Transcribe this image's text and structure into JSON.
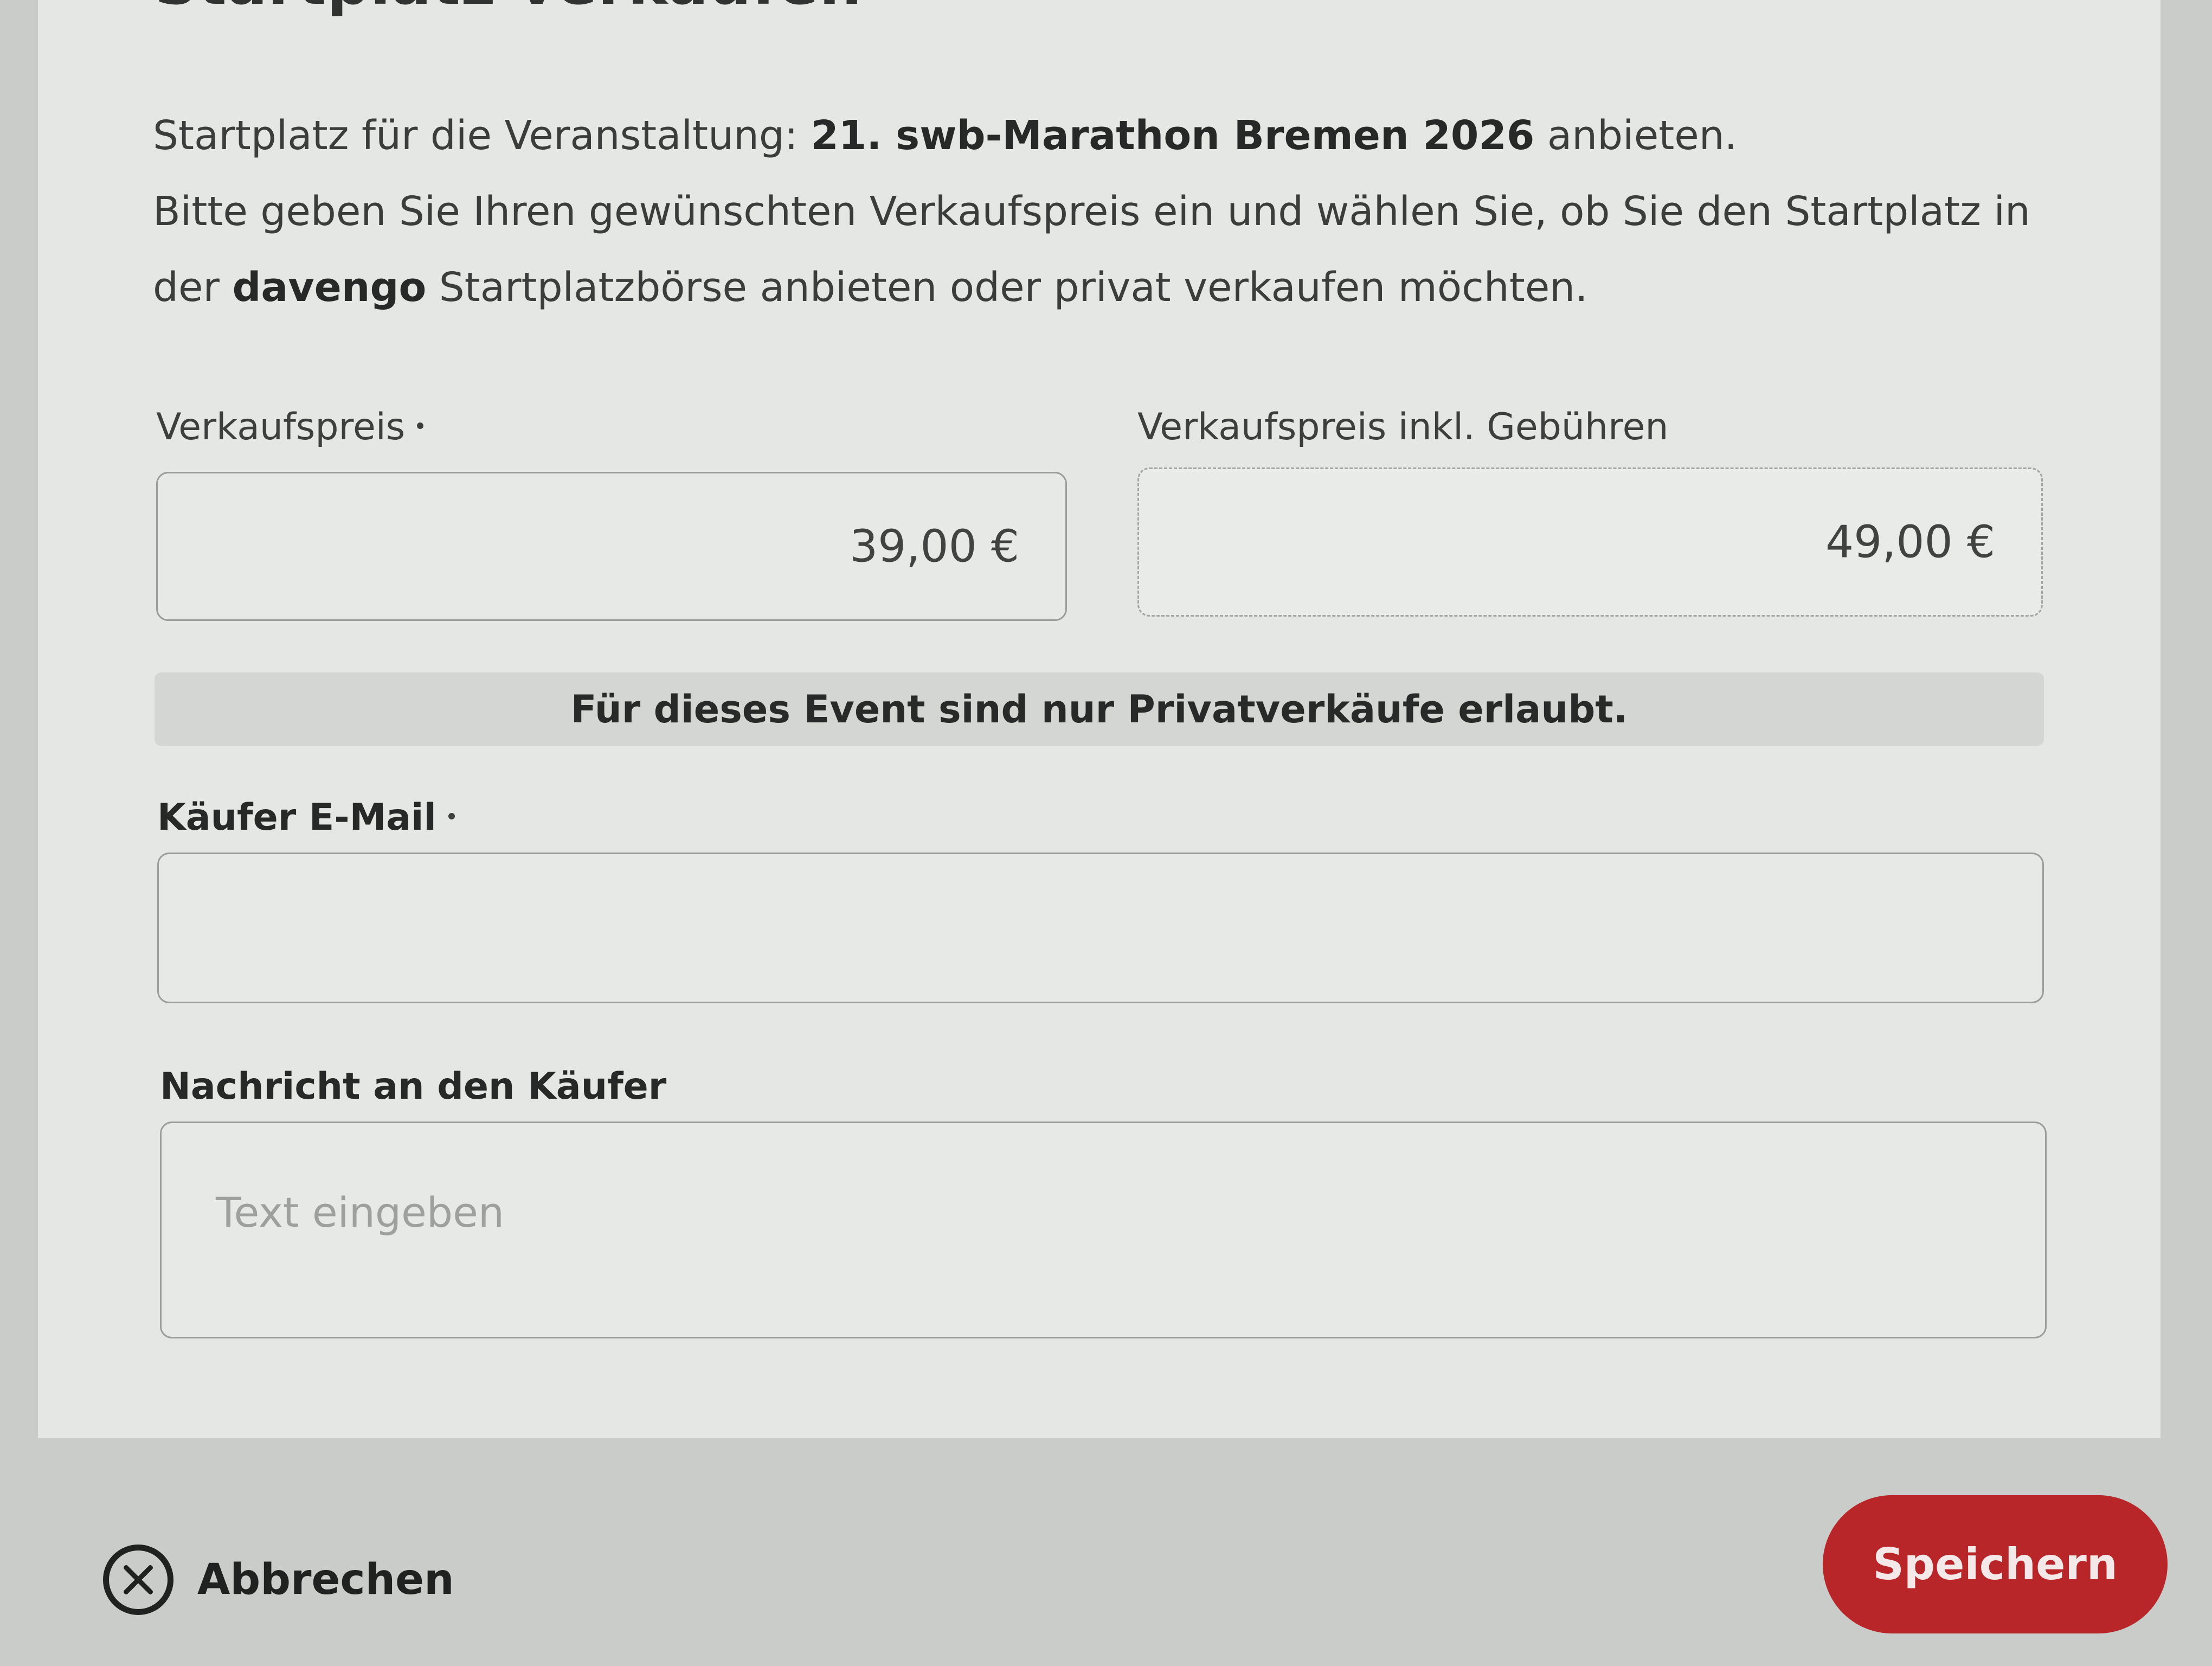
{
  "dialog": {
    "title": "Startplatz verkaufen",
    "intro": {
      "line1_prefix": "Startplatz für die Veranstaltung: ",
      "event_name": "21. swb-Marathon Bremen 2026",
      "line1_suffix": " anbieten.",
      "line2": "Bitte geben Sie Ihren gewünschten Verkaufspreis ein und wählen Sie, ob Sie den Startplatz in",
      "line3_prefix": "der ",
      "brand": "davengo",
      "line3_suffix": " Startplatzbörse anbieten oder privat verkaufen möchten."
    },
    "price": {
      "label": "Verkaufspreis",
      "value": "39,00 €"
    },
    "price_incl_fees": {
      "label": "Verkaufspreis inkl. Gebühren",
      "value": "49,00 €"
    },
    "notice": "Für dieses Event sind nur Privatverkäufe erlaubt.",
    "buyer_email": {
      "label": "Käufer E-Mail",
      "value": ""
    },
    "message": {
      "label": "Nachricht an den Käufer",
      "placeholder": "Text eingeben"
    }
  },
  "footer": {
    "cancel_label": "Abbrechen",
    "save_label": "Speichern",
    "save_color": "#b8262a"
  }
}
